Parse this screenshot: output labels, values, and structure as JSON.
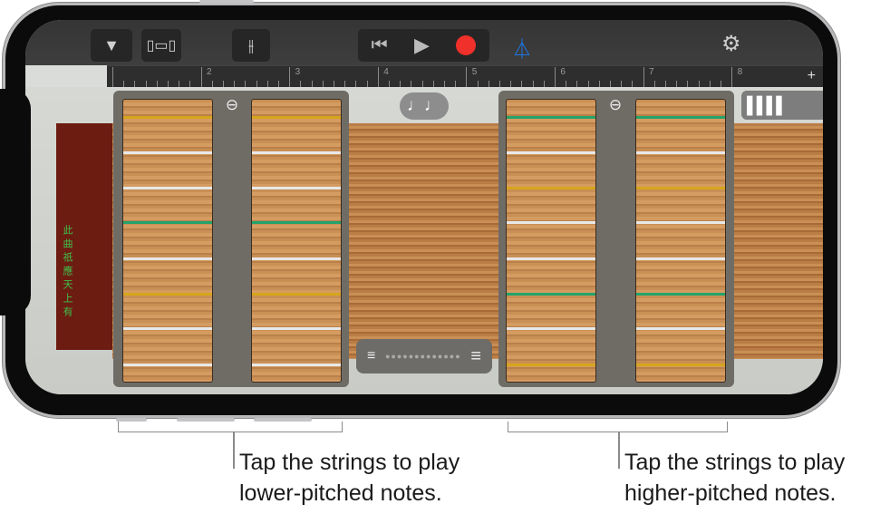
{
  "toolbar": {
    "browser_icon": "triangle-down-icon",
    "tracks_icon": "track-view-icon",
    "mixer_icon": "mixer-sliders-icon",
    "rewind_icon": "go-to-beginning-icon",
    "play_icon": "play-icon",
    "record_icon": "record-icon",
    "metronome_icon": "metronome-icon",
    "settings_icon": "gear-icon",
    "accent": "#1a7df5",
    "record_color": "#f0302a"
  },
  "ruler": {
    "labels": [
      "2",
      "3",
      "4",
      "5",
      "6",
      "7",
      "8"
    ],
    "add_label": "+"
  },
  "instrument": {
    "notes_label": "♩♩",
    "bars_label": "▌▌▌▌",
    "zoom_label": "⊖",
    "left_strings": [
      "#d7a51b",
      "#e8e8e8",
      "#e8e8e8",
      "#22a36b",
      "#e8e8e8",
      "#d7a51b",
      "#e8e8e8",
      "#e8e8e8"
    ],
    "right_strings": [
      "#22a36b",
      "#e8e8e8",
      "#d7a51b",
      "#e8e8e8",
      "#e8e8e8",
      "#22a36b",
      "#e8e8e8",
      "#d7a51b"
    ],
    "ornament_text": "此曲祇應天上有"
  },
  "callouts": {
    "left_line1": "Tap the strings to play",
    "left_line2": "lower-pitched notes.",
    "right_line1": "Tap the strings to play",
    "right_line2": "higher-pitched notes."
  }
}
